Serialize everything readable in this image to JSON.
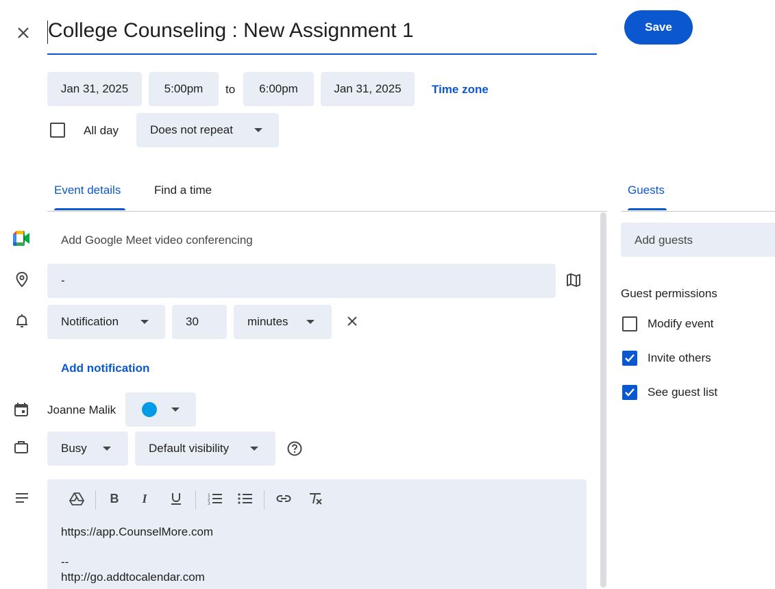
{
  "header": {
    "title": "College Counseling : New Assignment 1",
    "save_label": "Save"
  },
  "datetime": {
    "start_date": "Jan 31, 2025",
    "start_time": "5:00pm",
    "to_label": "to",
    "end_time": "6:00pm",
    "end_date": "Jan 31, 2025",
    "time_zone_label": "Time zone",
    "all_day_label": "All day",
    "repeat_value": "Does not repeat"
  },
  "tabs": {
    "event_details": "Event details",
    "find_a_time": "Find a time",
    "guests": "Guests"
  },
  "details": {
    "meet_label": "Add Google Meet video conferencing",
    "location_value": "-",
    "notification_type": "Notification",
    "notification_amount": "30",
    "notification_unit": "minutes",
    "add_notification_label": "Add notification",
    "calendar_owner": "Joanne Malik",
    "calendar_color": "#039be5",
    "availability": "Busy",
    "visibility": "Default visibility",
    "description_lines": [
      "https://app.CounselMore.com",
      "",
      "--",
      "http://go.addtocalendar.com"
    ]
  },
  "guests": {
    "add_placeholder": "Add guests",
    "permissions_title": "Guest permissions",
    "permissions": [
      {
        "label": "Modify event",
        "checked": false
      },
      {
        "label": "Invite others",
        "checked": true
      },
      {
        "label": "See guest list",
        "checked": true
      }
    ]
  },
  "colors": {
    "accent": "#0b57d0",
    "chip_bg": "#e9eef6",
    "text": "#1f1f1f"
  }
}
